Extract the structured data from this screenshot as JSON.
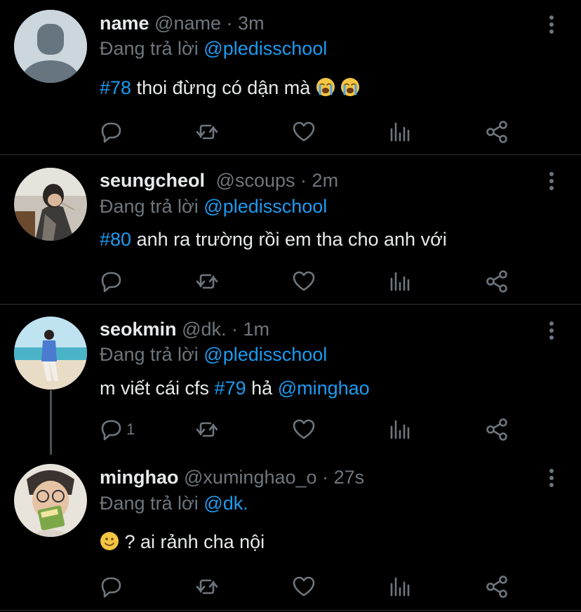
{
  "colors": {
    "background": "#000000",
    "text": "#e7e9ea",
    "muted": "#6e767d",
    "accent": "#1d9bf0",
    "divider": "#2f3336"
  },
  "tweets": [
    {
      "name": "name",
      "handle": "@name",
      "dot": "·",
      "time": "3m",
      "reply_prefix": "Đang trả lời",
      "reply_to": "@pledisschool",
      "hashtag": "#78",
      "text": "thoi đừng có dận mà",
      "emojis": [
        "loudly-crying-face",
        "loudly-crying-face"
      ],
      "reply_count": "",
      "avatar": "default-avatar"
    },
    {
      "name": "seungcheol",
      "handle": "@scoups",
      "dot": "·",
      "time": "2m",
      "reply_prefix": "Đang trả lời",
      "reply_to": "@pledisschool",
      "hashtag": "#80",
      "text": "anh ra trường rồi em tha cho anh với",
      "reply_count": "",
      "avatar": "photo-avatar"
    },
    {
      "name": "seokmin",
      "handle": "@dk.",
      "dot": "·",
      "time": "1m",
      "reply_prefix": "Đang trả lời",
      "reply_to": "@pledisschool",
      "text_before": "m viết cái cfs",
      "hashtag": "#79",
      "text_middle": "hả",
      "mention": "@minghao",
      "reply_count": "1",
      "avatar": "photo-avatar"
    },
    {
      "name": "minghao",
      "handle": "@xuminghao_o",
      "dot": "·",
      "time": "27s",
      "reply_prefix": "Đang trả lời",
      "reply_to": "@dk.",
      "emoji": "slightly-smiling-face",
      "text": "? ai rảnh cha nội",
      "reply_count": "",
      "avatar": "photo-avatar"
    }
  ],
  "actions": [
    "reply-icon",
    "retweet-icon",
    "like-icon",
    "analytics-icon",
    "share-icon",
    "more-icon"
  ]
}
